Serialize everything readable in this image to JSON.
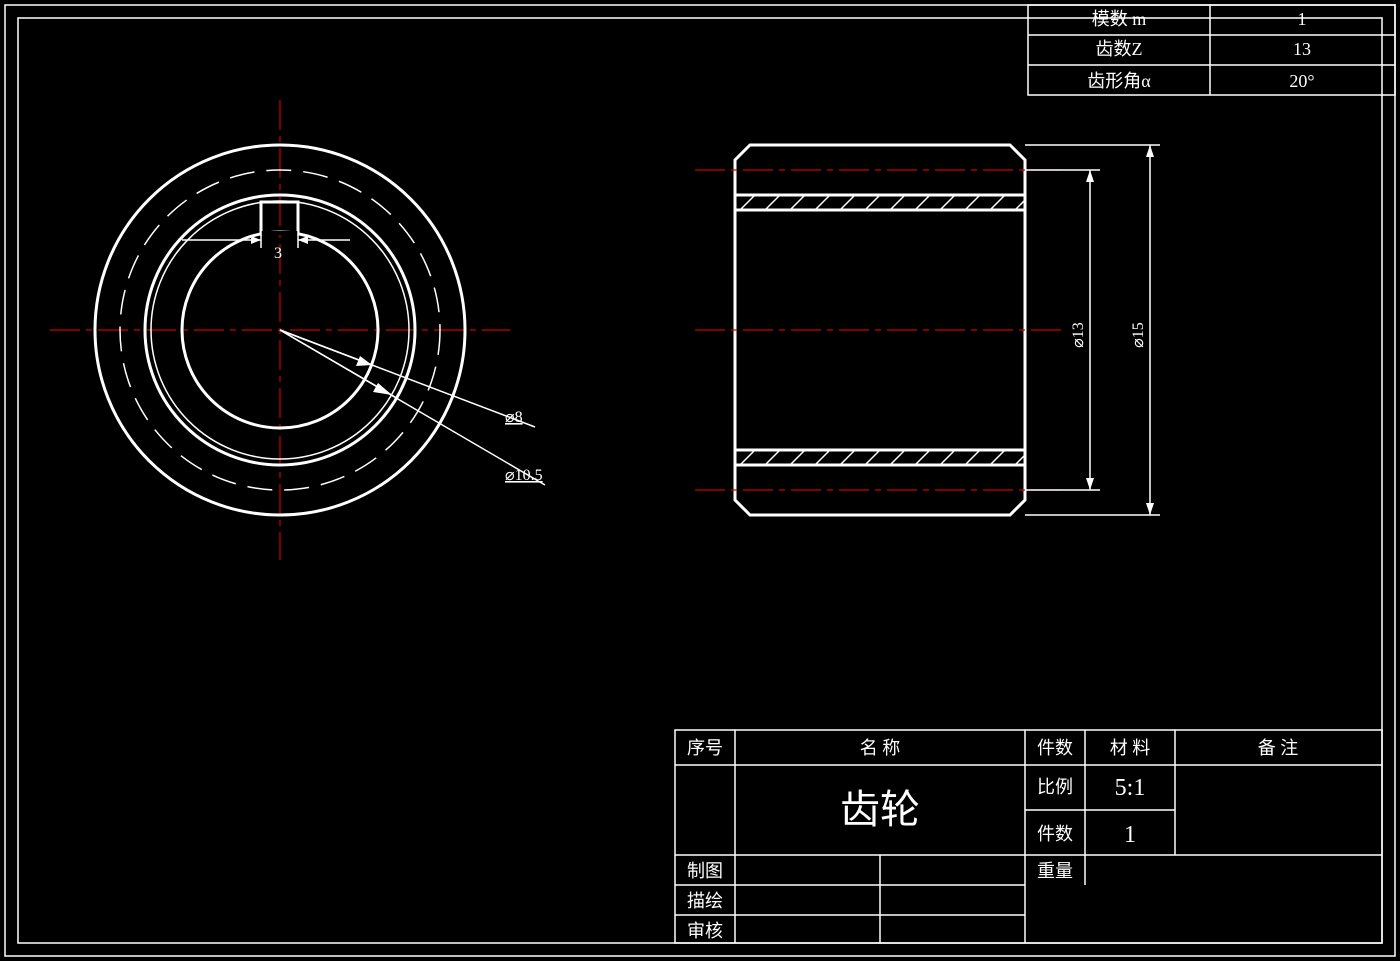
{
  "params_table": {
    "rows": [
      {
        "label": "模数 m",
        "value": "1"
      },
      {
        "label": "齿数Z",
        "value": "13"
      },
      {
        "label": "齿形角α",
        "value": "20°"
      }
    ]
  },
  "dimensions": {
    "keyway_width": "3",
    "bore_dia": "⌀8",
    "keyway_dia": "⌀10.5",
    "pitch_dia": "⌀13",
    "outer_dia": "⌀15"
  },
  "title_block": {
    "headers": {
      "seq": "序号",
      "name": "名    称",
      "qty": "件数",
      "material": "材  料",
      "remarks": "备    注"
    },
    "part_name": "齿轮",
    "scale_label": "比例",
    "scale_value": "5:1",
    "qty2_label": "件数",
    "qty2_value": "1",
    "drawn_by": "制图",
    "traced_by": "描绘",
    "checked_by": "审核",
    "weight": "重量"
  }
}
